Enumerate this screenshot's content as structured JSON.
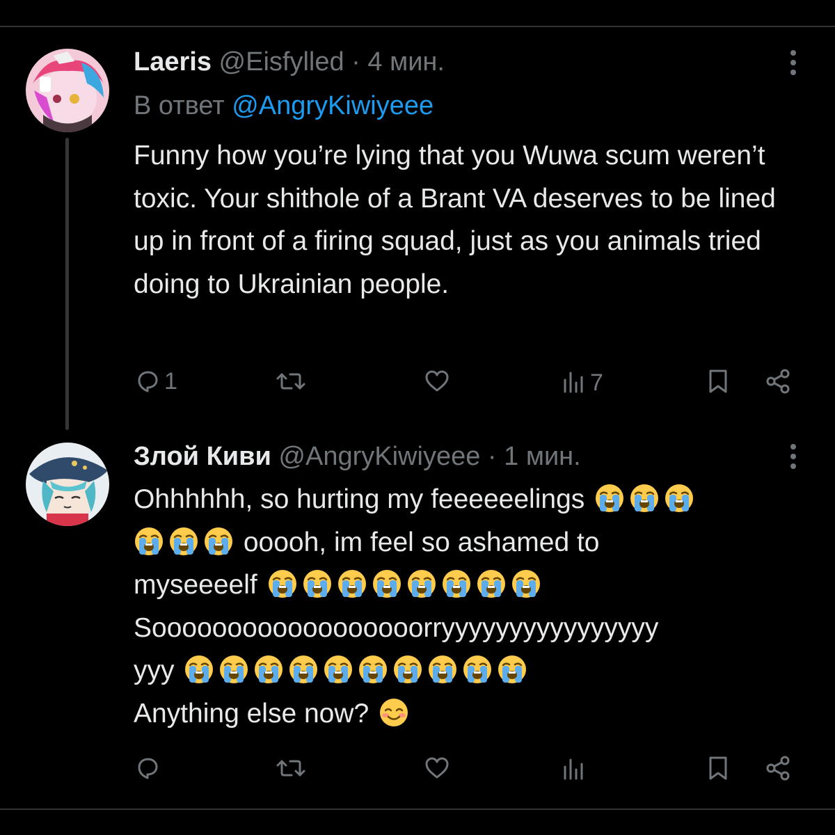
{
  "tweet1": {
    "display_name": "Laeris",
    "handle": "@Eisfylled",
    "separator": "·",
    "time": "4 мин.",
    "reply_prefix": "В ответ",
    "reply_handle": "@AngryKiwiyeee",
    "text": "Funny how you’re lying that you Wuwa scum weren’t toxic. Your shithole of a Brant VA deserves to be lined up in front of a firing squad, just as you animals tried doing to Ukrainian people.",
    "actions": {
      "reply_count": "1",
      "retweet_count": "",
      "like_count": "",
      "views_count": "7"
    }
  },
  "tweet2": {
    "display_name": "Злой Киви",
    "handle": "@AngryKiwiyeee",
    "separator": "·",
    "time": "1 мин.",
    "lines": {
      "l1": "Ohhhhhh, so hurting my feeeeeelings",
      "l2": "ooooh, im feel so ashamed to",
      "l3": "myseeeelf",
      "l4": "Soooooooooooooooooorryyyyyyyyyyyyyyyy",
      "l5": "yyy",
      "l6": "Anything else now?"
    },
    "actions": {
      "reply_count": "",
      "retweet_count": "",
      "like_count": "",
      "views_count": ""
    }
  },
  "icons": {
    "crying_emoji": "loudly-crying-face-icon",
    "smiling_emoji": "smiling-face-icon",
    "reply": "reply-icon",
    "retweet": "retweet-icon",
    "like": "heart-icon",
    "views": "views-icon",
    "bookmark": "bookmark-icon",
    "share": "share-icon"
  },
  "colors": {
    "background": "#000000",
    "text": "#e7e9ea",
    "muted": "#71767b",
    "link": "#1d9bf0"
  }
}
